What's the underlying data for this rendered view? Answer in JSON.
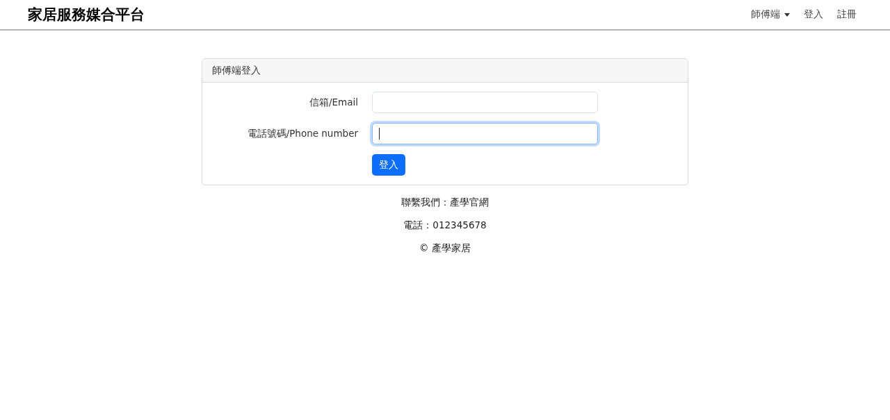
{
  "navbar": {
    "brand": "家居服務媒合平台",
    "items": [
      {
        "label": "師傅端",
        "kind": "dropdown"
      },
      {
        "label": "登入",
        "kind": "link"
      },
      {
        "label": "註冊",
        "kind": "link"
      }
    ]
  },
  "login_card": {
    "title": "師傅端登入",
    "fields": [
      {
        "label": "信箱/Email",
        "focused": false
      },
      {
        "label": "電話號碼/Phone number",
        "focused": true
      }
    ],
    "submit_button": "登入"
  },
  "footer": [
    "聯繫我們：產學官網",
    "電話：012345678",
    "© 產學家居"
  ]
}
